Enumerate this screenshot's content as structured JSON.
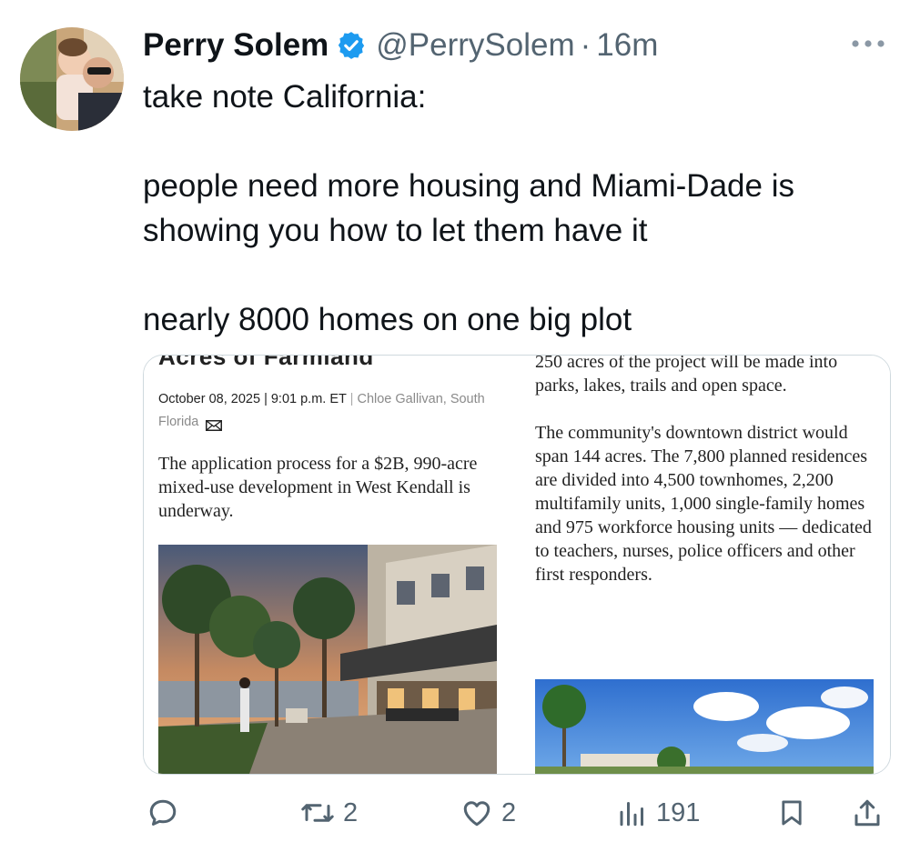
{
  "tweet": {
    "author_name": "Perry Solem",
    "handle": "@PerrySolem",
    "separator": "·",
    "time_ago": "16m",
    "text_lines": [
      "take note California:",
      "people need more housing and Miami-Dade is",
      "showing you how to let them have it",
      "nearly 8000 homes on one big plot"
    ]
  },
  "media": {
    "clipped_headline": "Acres of Farmland",
    "byline_date": "October 08, 2025 | 9:01 p.m. ET",
    "byline_separator": "|",
    "byline_author": "Chloe Gallivan, South Florida",
    "lede": "The application process for a $2B, 990-acre mixed-use development in West Kendall is underway.",
    "right_para1": "250 acres of the project will be made into parks, lakes, trails and open space.",
    "right_para2": "The community's downtown district would span 144 acres. The 7,800 planned residences are divided into 4,500 townhomes, 2,200 multifamily units, 1,000 single-family homes and 975 workforce housing units — dedicated to teachers, nurses, police officers and other first responders."
  },
  "actions": {
    "replies": "",
    "reposts": "2",
    "likes": "2",
    "views": "191"
  },
  "colors": {
    "text": "#0f1419",
    "secondary": "#536471",
    "verified": "#1d9bf0",
    "border": "#cfd9de"
  },
  "icons": [
    "verified-badge-icon",
    "more-icon",
    "reply-icon",
    "repost-icon",
    "like-icon",
    "views-icon",
    "bookmark-icon",
    "share-icon",
    "mail-icon"
  ]
}
